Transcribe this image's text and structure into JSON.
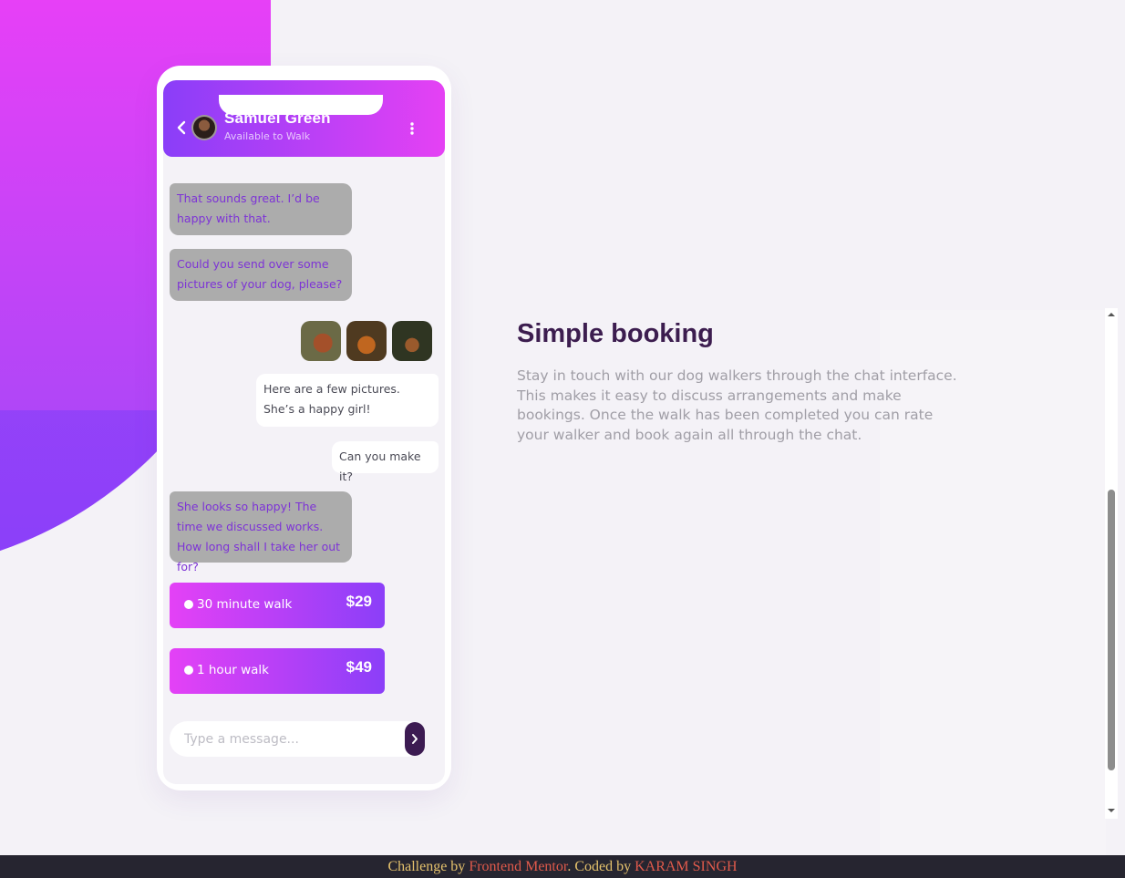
{
  "contact": {
    "name": "Samuel Green",
    "status": "Available to Walk"
  },
  "messages": [
    {
      "direction": "incoming",
      "text": "That sounds great. I’d be happy with that."
    },
    {
      "direction": "incoming",
      "text": "Could you send over some pictures of your dog, please?"
    },
    {
      "direction": "outgoing",
      "type": "images",
      "images": [
        "dog-photo-1",
        "dog-photo-2",
        "dog-photo-3"
      ]
    },
    {
      "direction": "outgoing",
      "text": "Here are a few pictures. She’s a happy girl!"
    },
    {
      "direction": "outgoing",
      "text": "Can you make it?"
    },
    {
      "direction": "incoming",
      "text": "She looks so happy! The time we discussed works. How long shall I take her out for?"
    }
  ],
  "options": [
    {
      "label": "30 minute walk",
      "price": "$29"
    },
    {
      "label": "1 hour walk",
      "price": "$49"
    }
  ],
  "composer": {
    "placeholder": "Type a message..."
  },
  "feature": {
    "title": "Simple booking",
    "body": "Stay in touch with our dog walkers through the chat interface. This makes it easy to discuss arrangements and make bookings. Once the walk has been completed you can rate your walker and book again all through the chat."
  },
  "footer": {
    "prefix": "Challenge by ",
    "challenge_link": "Frontend Mentor",
    "middle": ". Coded by ",
    "author_link": "KARAM SINGH"
  },
  "colors": {
    "accent_magenta": "#e541f4",
    "accent_violet": "#8a3ef8",
    "heading": "#3c1d4f",
    "footer_bg": "#262530"
  },
  "icons": {
    "back": "chevron-left-icon",
    "more": "more-vertical-icon",
    "send": "chevron-right-icon"
  }
}
